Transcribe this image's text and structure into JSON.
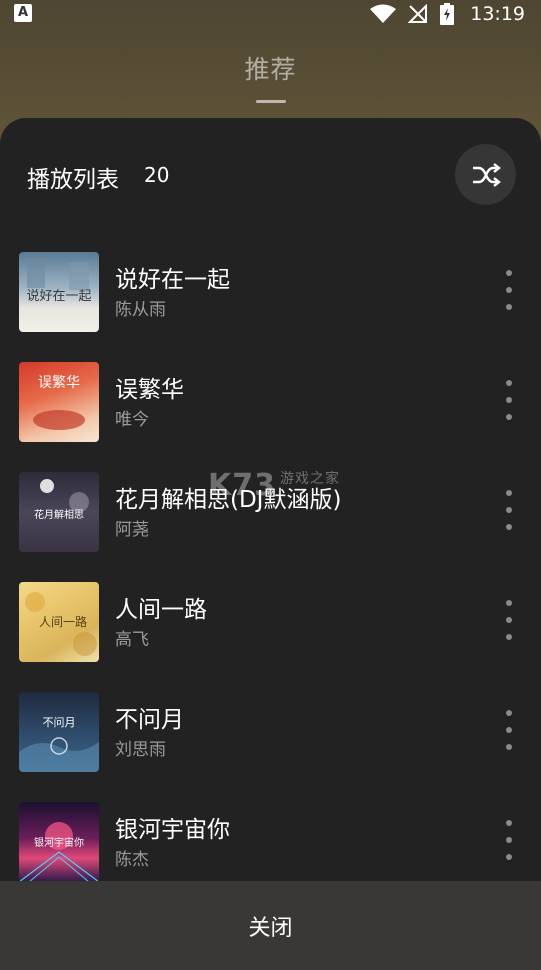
{
  "status": {
    "time": "13:19"
  },
  "header": {
    "tab_label": "推荐"
  },
  "playlist": {
    "title": "播放列表",
    "count": "20",
    "songs": [
      {
        "title": "说好在一起",
        "artist": "陈从雨",
        "cover_text": "说好在一起"
      },
      {
        "title": "误繁华",
        "artist": "唯今",
        "cover_text": "误繁华"
      },
      {
        "title": "花月解相思(DJ默涵版)",
        "artist": "阿荛",
        "cover_text": "花月解相思"
      },
      {
        "title": "人间一路",
        "artist": "高飞",
        "cover_text": "人间一路"
      },
      {
        "title": "不问月",
        "artist": "刘思雨",
        "cover_text": "不问月"
      },
      {
        "title": "银河宇宙你",
        "artist": "陈杰",
        "cover_text": "银河宇宙你"
      }
    ]
  },
  "footer": {
    "close_label": "关闭"
  },
  "watermark": {
    "brand": "K73",
    "sub": "游戏之家"
  },
  "icons": {
    "shuffle": "shuffle-icon",
    "more": "more-vertical-icon"
  }
}
